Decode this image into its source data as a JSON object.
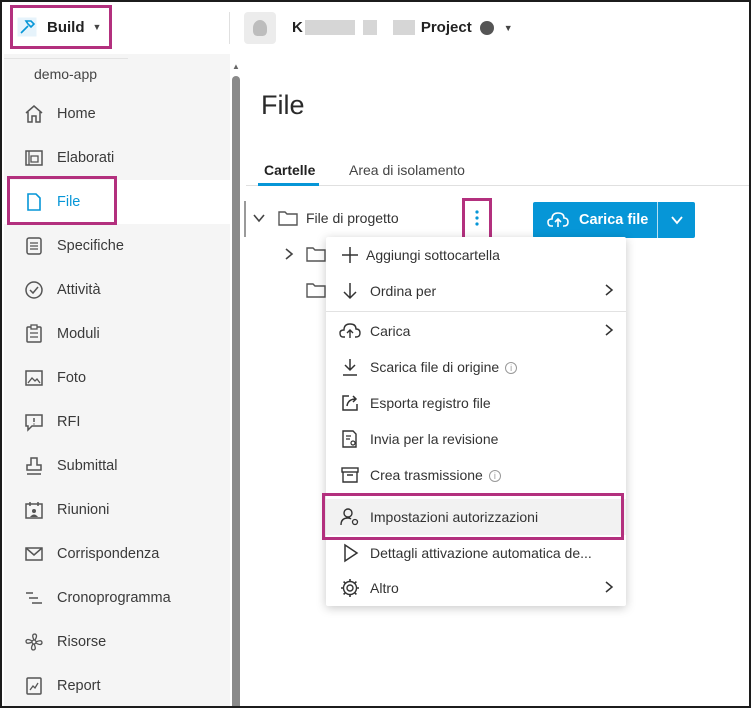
{
  "topbar": {
    "product_label": "Build",
    "project_prefix": "K",
    "project_suffix": "Project"
  },
  "sidebar": {
    "app_name": "demo-app",
    "items": [
      {
        "label": "Home",
        "icon": "home-icon"
      },
      {
        "label": "Elaborati",
        "icon": "sheets-icon"
      },
      {
        "label": "File",
        "icon": "file-icon",
        "active": true
      },
      {
        "label": "Specifiche",
        "icon": "specifications-icon"
      },
      {
        "label": "Attività",
        "icon": "check-circle-icon"
      },
      {
        "label": "Moduli",
        "icon": "clipboard-icon"
      },
      {
        "label": "Foto",
        "icon": "photo-icon"
      },
      {
        "label": "RFI",
        "icon": "rfi-icon"
      },
      {
        "label": "Submittal",
        "icon": "stamp-icon"
      },
      {
        "label": "Riunioni",
        "icon": "meeting-icon"
      },
      {
        "label": "Corrispondenza",
        "icon": "mail-icon"
      },
      {
        "label": "Cronoprogramma",
        "icon": "schedule-icon"
      },
      {
        "label": "Risorse",
        "icon": "fan-icon"
      },
      {
        "label": "Report",
        "icon": "report-icon"
      }
    ]
  },
  "main": {
    "title": "File",
    "tabs": [
      {
        "label": "Cartelle",
        "active": true
      },
      {
        "label": "Area di isolamento"
      }
    ],
    "tree": {
      "root": "File di progetto"
    },
    "upload_button": "Carica file"
  },
  "menu": {
    "items": [
      {
        "label": "Aggiungi sottocartella",
        "icon": "plus-icon"
      },
      {
        "label": "Ordina per",
        "icon": "arrow-down-icon",
        "submenu": true
      },
      {
        "label": "Carica",
        "icon": "cloud-upload-icon",
        "submenu": true
      },
      {
        "label": "Scarica file di origine",
        "icon": "download-icon",
        "info": true
      },
      {
        "label": "Esporta registro file",
        "icon": "export-icon"
      },
      {
        "label": "Invia per la revisione",
        "icon": "review-icon"
      },
      {
        "label": "Crea trasmissione",
        "icon": "archive-icon",
        "info": true
      },
      {
        "label": "Impostazioni autorizzazioni",
        "icon": "user-settings-icon"
      },
      {
        "label": "Dettagli attivazione automatica de...",
        "icon": "play-icon"
      },
      {
        "label": "Altro",
        "icon": "gear-icon",
        "submenu": true
      }
    ]
  },
  "colors": {
    "accent": "#0696d7",
    "highlight": "#b3307e",
    "sidebar_bg": "#f5f5f5"
  }
}
